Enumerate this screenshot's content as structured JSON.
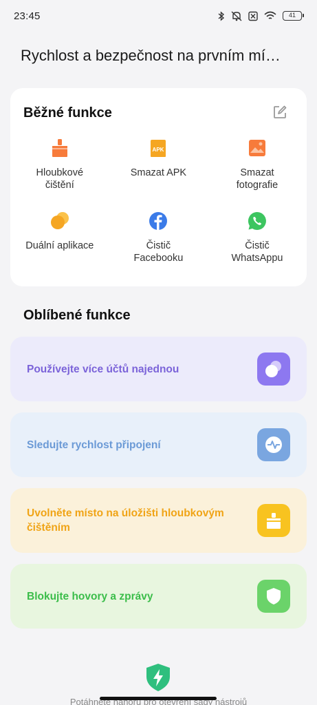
{
  "status_bar": {
    "time": "23:45",
    "battery": "41",
    "icons": [
      "bluetooth-icon",
      "mute-icon",
      "sim-off-icon",
      "wifi-icon",
      "battery-icon"
    ]
  },
  "page_title": "Rychlost a bezpečnost na prvním mí…",
  "common": {
    "title": "Běžné funkce",
    "edit_icon": "edit-icon",
    "tools": [
      {
        "label": "Hloubkové čištění",
        "icon": "broom-icon",
        "color": "#f77b3b"
      },
      {
        "label": "Smazat APK",
        "icon": "apk-icon",
        "color": "#f5a623"
      },
      {
        "label": "Smazat fotografie",
        "icon": "photo-icon",
        "color": "#f77b3b"
      },
      {
        "label": "Duální aplikace",
        "icon": "dual-apps-icon",
        "color": "#f5a623"
      },
      {
        "label": "Čistič Facebooku",
        "icon": "facebook-icon",
        "color": "#3b7be8"
      },
      {
        "label": "Čistič WhatsAppu",
        "icon": "whatsapp-icon",
        "color": "#3dc560"
      }
    ]
  },
  "favorites": {
    "title": "Oblíbené funkce",
    "items": [
      {
        "label": "Používejte více účtů najednou",
        "icon": "dual-apps-icon",
        "bg": "#ecebfb",
        "text_color": "#7b63d9",
        "icon_bg": "#8d78f0"
      },
      {
        "label": "Sledujte rychlost připojení",
        "icon": "speed-monitor-icon",
        "bg": "#e8f0fa",
        "text_color": "#6b9ad6",
        "icon_bg": "#7aa6e0"
      },
      {
        "label": "Uvolněte místo na úložišti hloubkovým čištěním",
        "icon": "cleaner-icon",
        "bg": "#fbf1da",
        "text_color": "#f0a416",
        "icon_bg": "#f8c320"
      },
      {
        "label": "Blokujte hovory a zprávy",
        "icon": "block-shield-icon",
        "bg": "#e8f6df",
        "text_color": "#3bbd4a",
        "icon_bg": "#6bd36a"
      }
    ]
  },
  "bottom_hint": "Potáhněte nahoru pro otevření sady nástrojů"
}
